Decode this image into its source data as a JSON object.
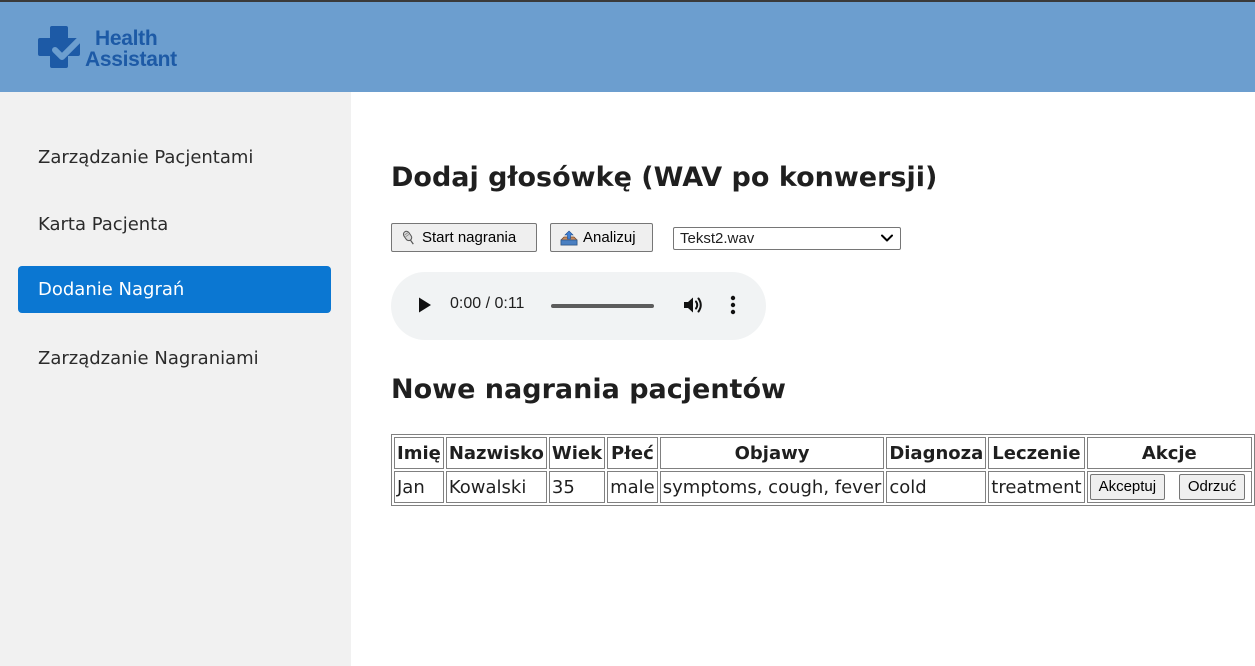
{
  "app": {
    "logo_line1": "Health",
    "logo_line2": "Assistant",
    "brand_color": "#1d5aa6",
    "header_color": "#6c9ecf",
    "accent_color": "#0b77d2"
  },
  "sidebar": {
    "items": [
      {
        "label": "Zarządzanie Pacjentami",
        "active": false
      },
      {
        "label": "Karta Pacjenta",
        "active": false
      },
      {
        "label": "Dodanie Nagrań",
        "active": true
      },
      {
        "label": "Zarządzanie Nagraniami",
        "active": false
      }
    ]
  },
  "upload": {
    "title": "Dodaj głosówkę (WAV po konwersji)",
    "record_button": {
      "icon": "microphone-icon",
      "label": "Start nagrania"
    },
    "analyze_button": {
      "icon": "outbox-tray-icon",
      "label": "Analizuj"
    },
    "file_select": {
      "selected": "Tekst2.wav"
    },
    "player": {
      "time": "0:00 / 0:11",
      "progress": 0
    }
  },
  "recordings": {
    "title": "Nowe nagrania pacjentów",
    "columns": [
      "Imię",
      "Nazwisko",
      "Wiek",
      "Płeć",
      "Objawy",
      "Diagnoza",
      "Leczenie",
      "Akcje"
    ],
    "rows": [
      {
        "imie": "Jan",
        "nazwisko": "Kowalski",
        "wiek": "35",
        "plec": "male",
        "objawy": "symptoms, cough, fever",
        "diagnoza": "cold",
        "leczenie": "treatment",
        "accept_label": "Akceptuj",
        "reject_label": "Odrzuć"
      }
    ]
  }
}
